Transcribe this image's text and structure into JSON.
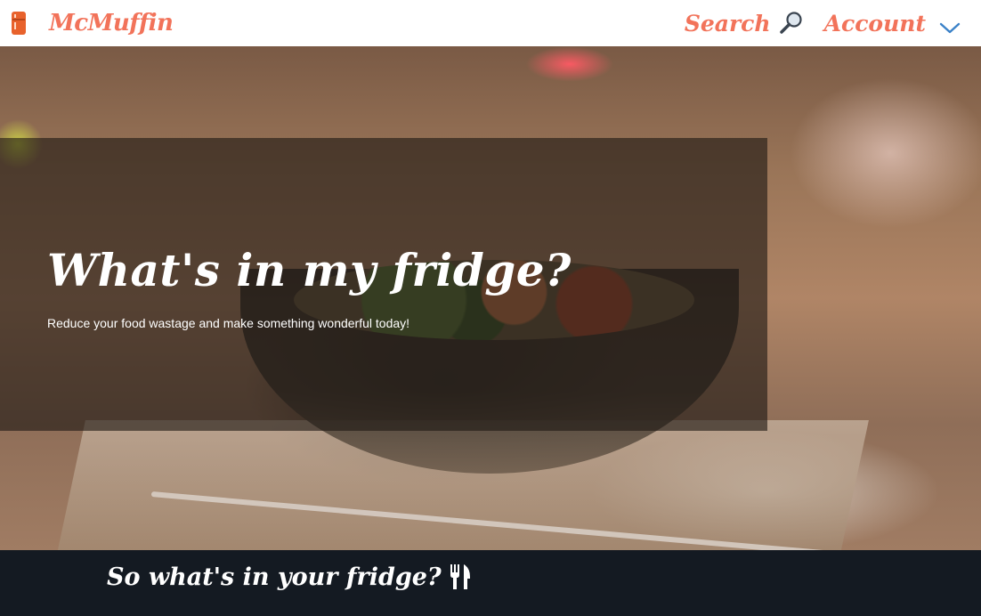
{
  "navbar": {
    "brand_name": "McMuffin",
    "brand_icon": "fridge-icon",
    "search_label": "Search",
    "search_icon": "magnifier-icon",
    "account_label": "Account",
    "account_icon": "chevron-down-icon",
    "accent_color": "#f2735a"
  },
  "hero": {
    "title": "What's in my fridge?",
    "subtitle": "Reduce your food wastage and make something wonderful today!"
  },
  "section": {
    "heading": "So what's in your fridge?",
    "heading_icon": "cutlery-icon",
    "band_color": "#141a22"
  }
}
